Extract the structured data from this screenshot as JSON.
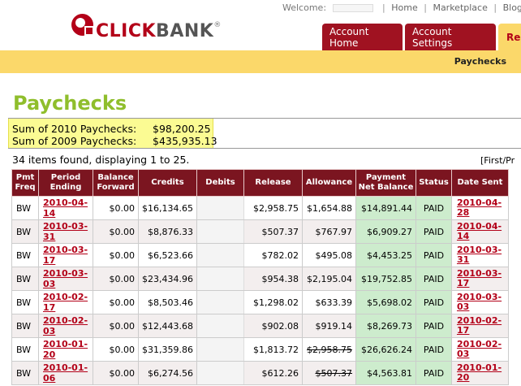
{
  "header": {
    "logo": {
      "click": "CLICK",
      "bank": "BANK",
      "reg": "®"
    },
    "welcome_label": "Welcome:",
    "links": [
      "Home",
      "Marketplace",
      "Blog",
      "L"
    ],
    "tabs": [
      {
        "label": "Account Home"
      },
      {
        "label": "Account Settings"
      },
      {
        "label": "Re"
      }
    ],
    "breadcrumb": "Paychecks"
  },
  "page": {
    "title": "Paychecks",
    "sums": [
      {
        "label": "Sum of 2010 Paychecks:",
        "value": "$98,200.25"
      },
      {
        "label": "Sum of 2009 Paychecks:",
        "value": "$435,935.13"
      }
    ],
    "count_text": "34 items found, displaying 1 to 25.",
    "pager_text": "[First/Pr"
  },
  "table": {
    "headers": [
      "Pmt Freq",
      "Period Ending",
      "Balance Forward",
      "Credits",
      "Debits",
      "Release",
      "Allowance",
      "Payment Net Balance",
      "Status",
      "Date Sent"
    ],
    "rows": [
      {
        "freq": "BW",
        "period": "2010-04-14",
        "balance": "$0.00",
        "credits": "$16,134.65",
        "debits": "",
        "release": "$2,958.75",
        "allowance": "$1,654.88",
        "allowance_struck": false,
        "net": "$14,891.44",
        "status": "PAID",
        "date1": "2010-04-",
        "date2": "28"
      },
      {
        "freq": "BW",
        "period": "2010-03-31",
        "balance": "$0.00",
        "credits": "$8,876.33",
        "debits": "",
        "release": "$507.37",
        "allowance": "$767.97",
        "allowance_struck": false,
        "net": "$6,909.27",
        "status": "PAID",
        "date1": "2010-04-",
        "date2": "14"
      },
      {
        "freq": "BW",
        "period": "2010-03-17",
        "balance": "$0.00",
        "credits": "$6,523.66",
        "debits": "",
        "release": "$782.02",
        "allowance": "$495.08",
        "allowance_struck": false,
        "net": "$4,453.25",
        "status": "PAID",
        "date1": "2010-03-",
        "date2": "31"
      },
      {
        "freq": "BW",
        "period": "2010-03-03",
        "balance": "$0.00",
        "credits": "$23,434.96",
        "debits": "",
        "release": "$954.38",
        "allowance": "$2,195.04",
        "allowance_struck": false,
        "net": "$19,752.85",
        "status": "PAID",
        "date1": "2010-03-",
        "date2": "17"
      },
      {
        "freq": "BW",
        "period": "2010-02-17",
        "balance": "$0.00",
        "credits": "$8,503.46",
        "debits": "",
        "release": "$1,298.02",
        "allowance": "$633.39",
        "allowance_struck": false,
        "net": "$5,698.02",
        "status": "PAID",
        "date1": "2010-03-",
        "date2": "03"
      },
      {
        "freq": "BW",
        "period": "2010-02-03",
        "balance": "$0.00",
        "credits": "$12,443.68",
        "debits": "",
        "release": "$902.08",
        "allowance": "$919.14",
        "allowance_struck": false,
        "net": "$8,269.73",
        "status": "PAID",
        "date1": "2010-02-",
        "date2": "17"
      },
      {
        "freq": "BW",
        "period": "2010-01-20",
        "balance": "$0.00",
        "credits": "$31,359.86",
        "debits": "",
        "release": "$1,813.72",
        "allowance": "$2,958.75",
        "allowance_struck": true,
        "net": "$26,626.24",
        "status": "PAID",
        "date1": "2010-02-",
        "date2": "03"
      },
      {
        "freq": "BW",
        "period": "2010-01-06",
        "balance": "$0.00",
        "credits": "$6,274.56",
        "debits": "",
        "release": "$612.26",
        "allowance": "$507.37",
        "allowance_struck": true,
        "net": "$4,563.81",
        "status": "PAID",
        "date1": "2010-01-",
        "date2": "20"
      }
    ]
  },
  "colors": {
    "brand_red": "#b30018",
    "tab_red": "#a01221",
    "subbar_yellow": "#fbd86a",
    "title_green": "#8fbe2c",
    "table_header": "#7b1520",
    "paid_green": "#cdeccd",
    "highlight_yellow": "#fbfb93"
  }
}
